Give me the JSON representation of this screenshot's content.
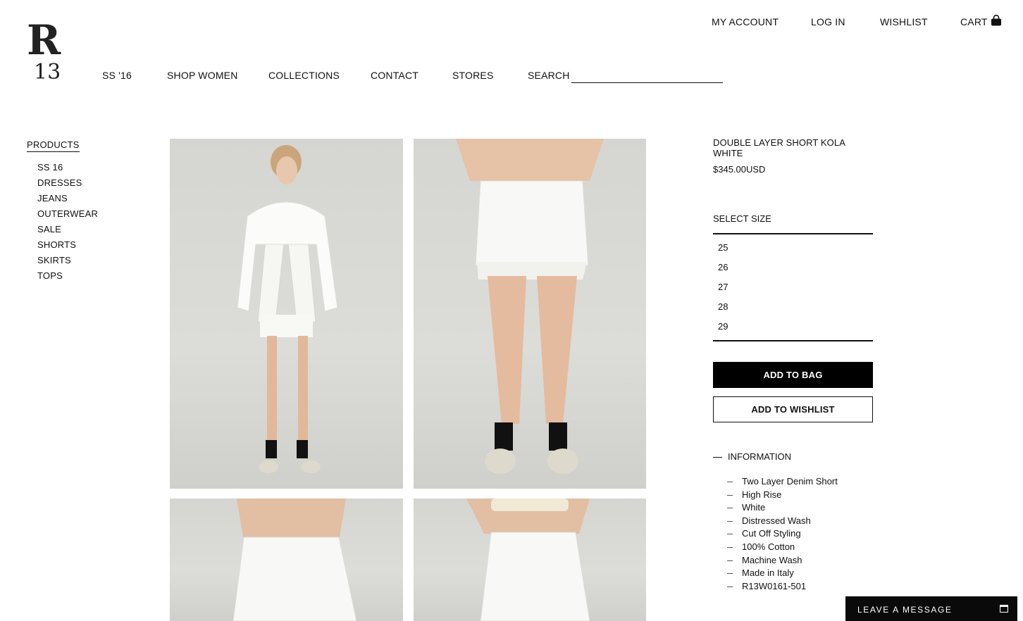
{
  "brand": {
    "logo_top": "R",
    "logo_bottom": "13"
  },
  "top_nav": {
    "account": "MY ACCOUNT",
    "login": "LOG IN",
    "wishlist": "WISHLIST",
    "cart": "CART"
  },
  "main_nav": {
    "ss16": "SS '16",
    "shop_women": "SHOP WOMEN",
    "collections": "COLLECTIONS",
    "contact": "CONTACT",
    "stores": "STORES",
    "search": "SEARCH"
  },
  "search": {
    "value": ""
  },
  "sidebar": {
    "heading": "PRODUCTS",
    "items": [
      "SS 16",
      "DRESSES",
      "JEANS",
      "OUTERWEAR",
      "SALE",
      "SHORTS",
      "SKIRTS",
      "TOPS"
    ]
  },
  "product": {
    "title": "DOUBLE LAYER SHORT KOLA WHITE",
    "price": "$345.00USD",
    "select_size_label": "SELECT SIZE",
    "sizes": [
      "25",
      "26",
      "27",
      "28",
      "29"
    ],
    "add_to_bag": "ADD TO BAG",
    "add_to_wishlist": "ADD TO WISHLIST",
    "information_label": "INFORMATION",
    "information": [
      "Two Layer Denim Short",
      "High Rise",
      "White",
      "Distressed Wash",
      "Cut Off Styling",
      "100% Cotton",
      "Machine Wash",
      "Made in Italy",
      "R13W0161-501"
    ]
  },
  "chat": {
    "label": "LEAVE A MESSAGE"
  }
}
